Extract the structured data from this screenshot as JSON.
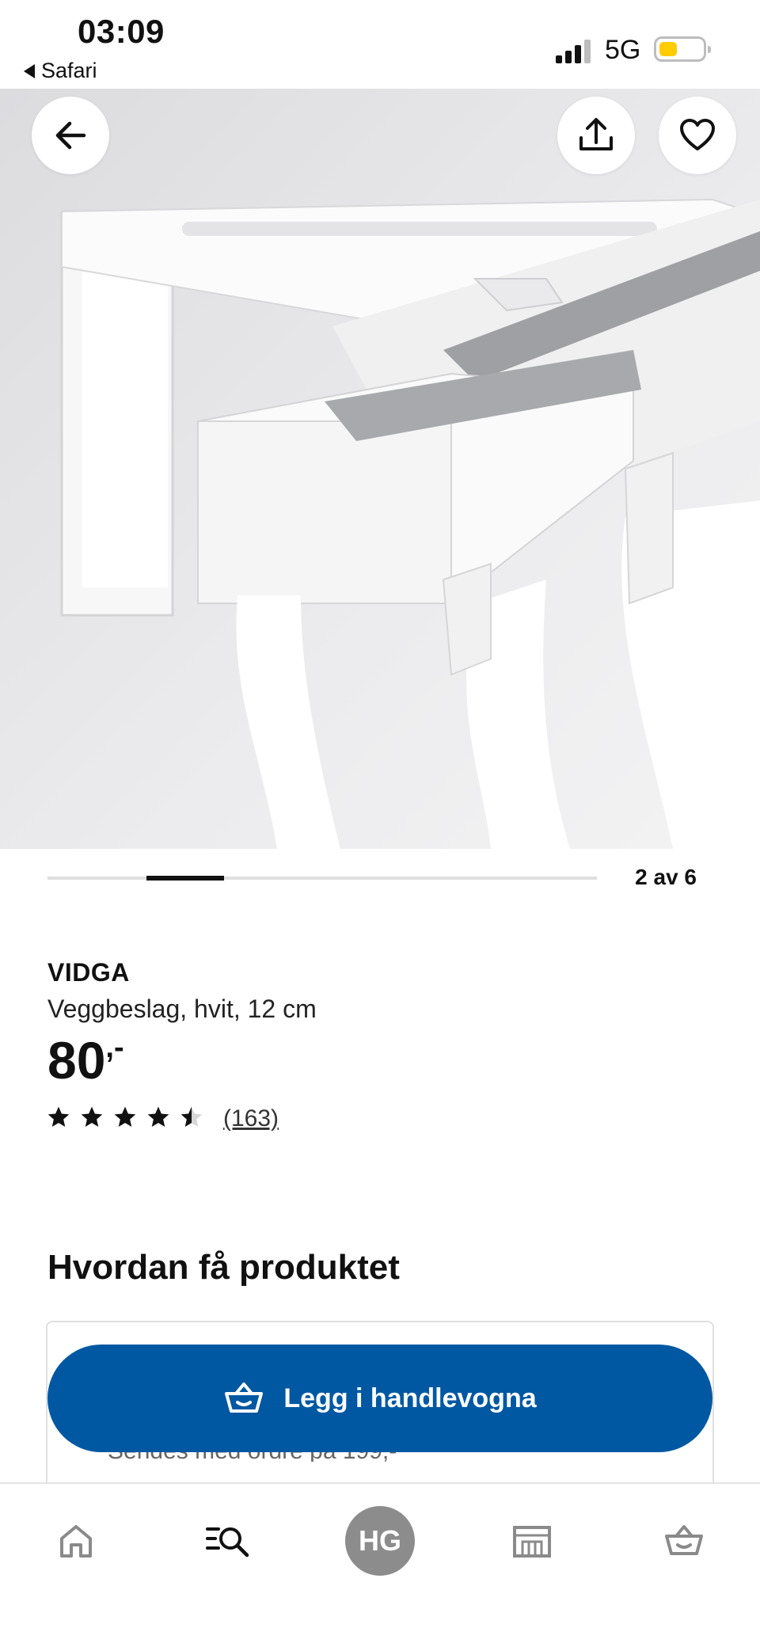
{
  "status_bar": {
    "time": "03:09",
    "back_app": "Safari",
    "network": "5G"
  },
  "colors": {
    "accent": "#0058a3",
    "battery": "#ffcc00"
  },
  "hero": {
    "back_icon": "arrow-left-icon",
    "share_icon": "share-icon",
    "favorite_icon": "heart-icon"
  },
  "carousel": {
    "counter": "2 av 6",
    "current": 2,
    "total": 6
  },
  "product": {
    "brand": "VIDGA",
    "description": "Veggbeslag, hvit, 12 cm",
    "price": "80",
    "price_suffix": ",-",
    "rating": 4.5,
    "reviews": "(163)"
  },
  "availability": {
    "title": "Hvordan få produktet",
    "delivery_text": "Sendes med ordre på 199,-"
  },
  "cta": {
    "add_to_cart": "Legg i handlevogna"
  },
  "bottom_nav": {
    "items": [
      {
        "icon": "home-icon"
      },
      {
        "icon": "search-list-icon"
      },
      {
        "label": "HG"
      },
      {
        "icon": "store-icon"
      },
      {
        "icon": "cart-icon"
      }
    ]
  }
}
